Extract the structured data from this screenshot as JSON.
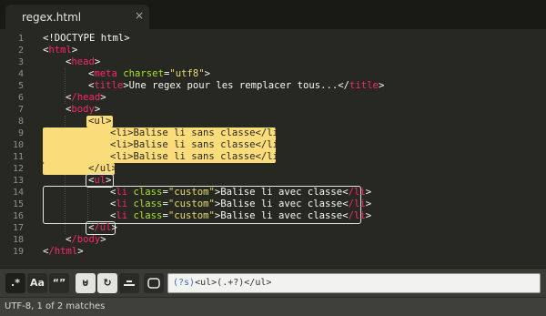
{
  "tab": {
    "title": "regex.html",
    "close": "×"
  },
  "lines": [
    {
      "n": "1"
    },
    {
      "n": "2"
    },
    {
      "n": "3"
    },
    {
      "n": "4"
    },
    {
      "n": "5"
    },
    {
      "n": "6"
    },
    {
      "n": "7"
    },
    {
      "n": "8"
    },
    {
      "n": "9"
    },
    {
      "n": "10"
    },
    {
      "n": "11"
    },
    {
      "n": "12"
    },
    {
      "n": "13"
    },
    {
      "n": "14"
    },
    {
      "n": "15"
    },
    {
      "n": "16"
    },
    {
      "n": "17"
    },
    {
      "n": "18"
    },
    {
      "n": "19"
    }
  ],
  "code": {
    "l1": "<!DOCTYPE html>",
    "l2_tag": "html",
    "l3_tag": "head",
    "l4_tag": "meta",
    "l4_attr": "charset",
    "l4_val": "\"utf8\"",
    "l5_tag": "title",
    "l5_text": "Une regex pour les remplacer tous...",
    "l6_tag": "/head",
    "l7_tag": "body",
    "ul_open": "<ul>",
    "li_plain": "<li>Balise li sans classe</li>",
    "ul_close": "</ul>",
    "ul_tag": "ul",
    "li_tag": "li",
    "li_attr": "class",
    "li_val": "\"custom\"",
    "li_text": "Balise li avec classe",
    "li_close": "/li",
    "ul_end": "/ul",
    "body_end": "/body",
    "html_end": "/html"
  },
  "findbar": {
    "regex_btn": ".*",
    "case_btn": "Aa",
    "word_btn": "“”",
    "wrap_btn": "⊍",
    "selection_btn": "↻",
    "highlight_btn": "▭",
    "query_prefix": "(?s)",
    "query_rest": "<ul>(.+?)</ul>"
  },
  "status": {
    "text": "UTF-8, 1 of 2 matches"
  }
}
